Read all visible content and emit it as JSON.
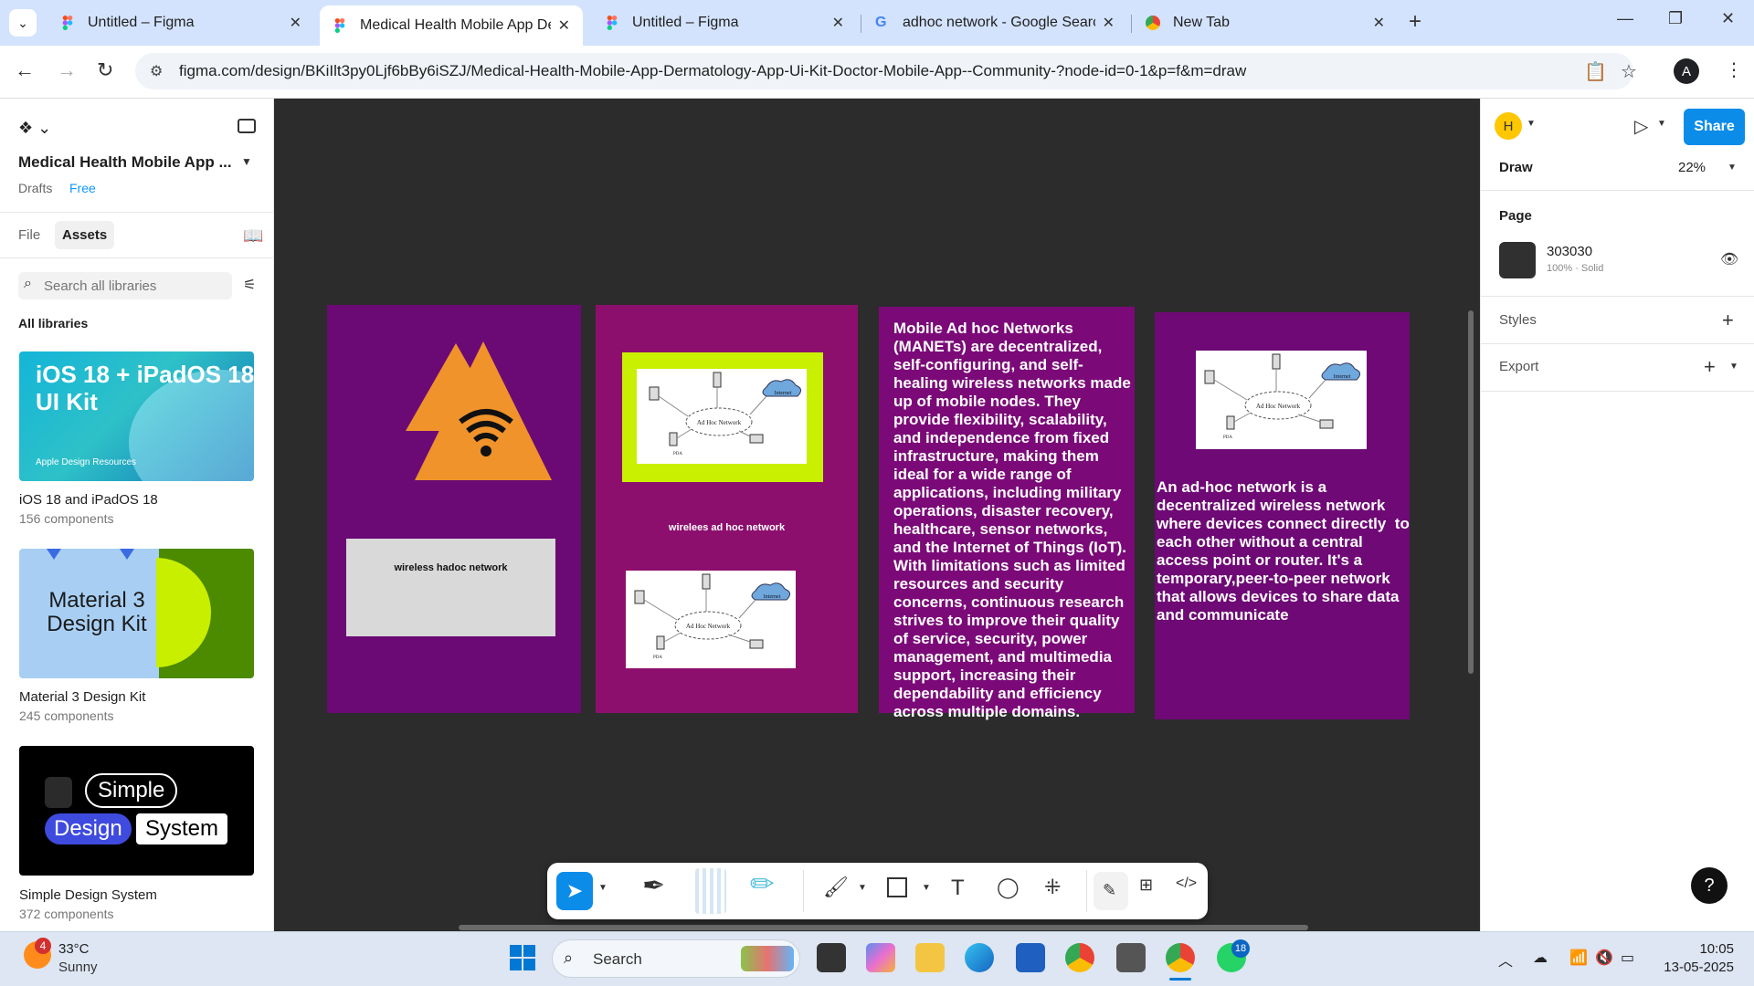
{
  "browser": {
    "tabs": [
      {
        "label": "Untitled – Figma",
        "icon": "figma-icon"
      },
      {
        "label": "Medical Health Mobile App Der",
        "icon": "figma-icon",
        "active": true
      },
      {
        "label": "Untitled – Figma",
        "icon": "figma-icon"
      },
      {
        "label": "adhoc network - Google Search",
        "icon": "google-icon"
      },
      {
        "label": "New Tab",
        "icon": "chrome-icon"
      }
    ],
    "url": "figma.com/design/BKiIlt3py0Ljf6bBy6iSZJ/Medical-Health-Mobile-App-Dermatology-App-Ui-Kit-Doctor-Mobile-App--Community-?node-id=0-1&p=f&m=draw",
    "profile_initial": "A"
  },
  "left_panel": {
    "file_title": "Medical Health Mobile App ...",
    "drafts": "Drafts",
    "plan": "Free",
    "tab_file": "File",
    "tab_assets": "Assets",
    "search_placeholder": "Search all libraries",
    "all_libraries": "All libraries",
    "libraries": [
      {
        "thumb_title": "iOS 18 + iPadOS 18 UI Kit",
        "thumb_sub": "Apple Design Resources",
        "name": "iOS 18 and iPadOS 18",
        "count": "156 components"
      },
      {
        "thumb_title": "Material 3 Design Kit",
        "name": "Material 3 Design Kit",
        "count": "245 components"
      },
      {
        "thumb_words": [
          "Simple",
          "Design",
          "System"
        ],
        "name": "Simple Design System",
        "count": "372 components"
      }
    ]
  },
  "canvas": {
    "frame1_label": "wireless hadoc network",
    "frame2_label": "wirelees ad hoc network",
    "frame3_text": "Mobile Ad hoc Networks (MANETs) are decentralized, self-configuring, and self-healing wireless networks made up of mobile nodes. They provide flexibility, scalability, and independence from fixed infrastructure, making them ideal for a wide range of applications, including military operations, disaster recovery, healthcare, sensor networks, and the Internet of Things (IoT). With limitations such as limited resources and security concerns, continuous research strives to improve their quality of service, security, power management, and multimedia support, increasing their dependability and efficiency across multiple domains.",
    "frame4_text": "An ad-hoc network is a decentralized wireless network  where devices connect directly  to each other without a central access point or router. It's a  temporary,peer-to-peer network that allows devices to share data and communicate",
    "diagram": {
      "center": "Ad Hoc Network",
      "cloud": "Internet",
      "pda": "PDA"
    },
    "colors": {
      "frame1": "#6b0a75",
      "frame2": "#8c0f6e",
      "frame3": "#7b0a78",
      "frame4": "#6e0975",
      "triangle": "#f0932b",
      "lime": "#c8f000"
    }
  },
  "right_panel": {
    "avatar_initial": "H",
    "share": "Share",
    "mode": "Draw",
    "zoom": "22%",
    "page": "Page",
    "page_color": "303030",
    "page_opacity": "100% · Solid",
    "styles": "Styles",
    "export": "Export",
    "help": "?"
  },
  "taskbar": {
    "weather_badge": "4",
    "temp": "33°C",
    "condition": "Sunny",
    "search": "Search",
    "whatsapp_badge": "18",
    "time": "10:05",
    "date": "13-05-2025"
  }
}
